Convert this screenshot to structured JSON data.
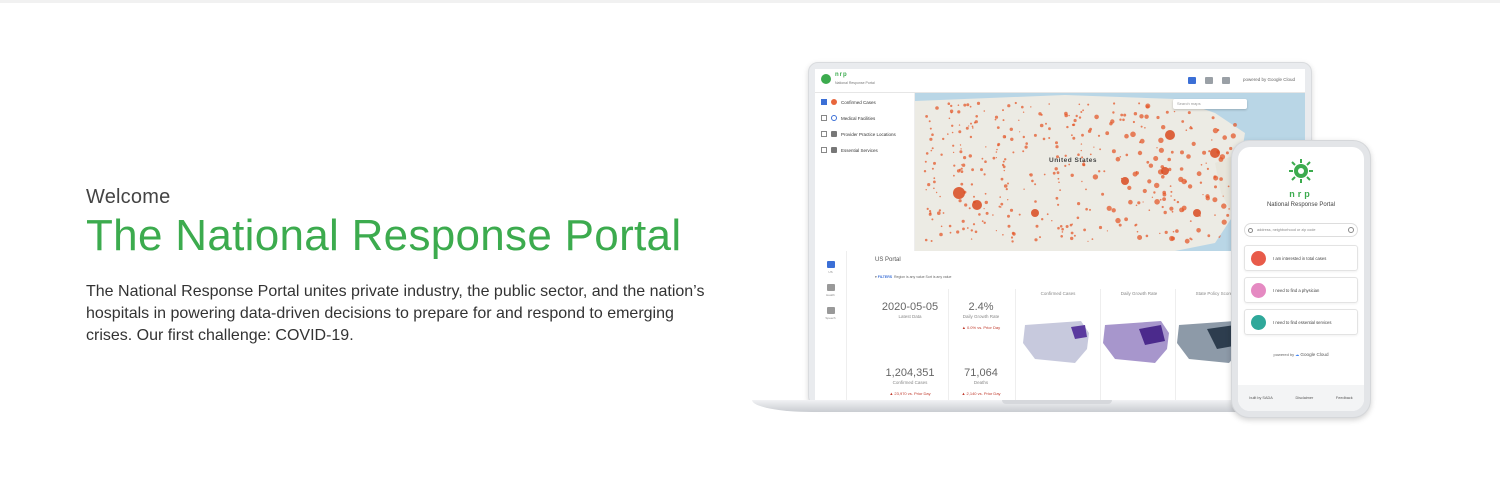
{
  "hero": {
    "welcome": "Welcome",
    "title": "The National Response Portal",
    "description": "The National Response Portal unites private industry, the public sector, and the nation’s hospitals in powering data-driven decisions to prepare for and respond to emerging crises. Our first challenge: COVID-19."
  },
  "laptop": {
    "app": {
      "logo_text": "nrp",
      "logo_sub": "National Response Portal",
      "powered_by": "powered by Google Cloud"
    },
    "layers": [
      {
        "label": "Confirmed Cases",
        "checked": true,
        "color": "#e8663c"
      },
      {
        "label": "Medical Facilities",
        "checked": false,
        "color": "#3b6fd6"
      },
      {
        "label": "Provider Practice Locations",
        "checked": false,
        "color": "#777777"
      },
      {
        "label": "Essential Services",
        "checked": false,
        "color": "#777777"
      }
    ],
    "map": {
      "search_placeholder": "Search maps",
      "country_label": "United States"
    },
    "dashboard": {
      "title": "US Portal",
      "filters_label": "FILTERS",
      "filters_detail": "Region is any value   Sort is any value",
      "nav": [
        "US",
        "Health",
        "Speech"
      ],
      "latest_date": {
        "value": "2020-05-05",
        "label": "Latest Data"
      },
      "growth_rate": {
        "value": "2.4%",
        "label": "Daily Growth Rate",
        "delta": "▲ 0.0% vs. Prior Day"
      },
      "confirmed": {
        "value": "1,204,351",
        "label": "Confirmed Cases",
        "delta": "▲ 23,970 vs. Prior Day"
      },
      "deaths": {
        "value": "71,064",
        "label": "Deaths",
        "delta": "▲ 2,140 vs. Prior Day"
      },
      "map_columns": [
        "Confirmed Cases",
        "Daily Growth Rate",
        "State Policy Score"
      ]
    }
  },
  "phone": {
    "logo_text": "nrp",
    "subtitle": "National Response Portal",
    "search_placeholder": "address, neighborhood or zip code",
    "buttons": [
      {
        "label": "I am interested in total cases",
        "color": "#e85b4a"
      },
      {
        "label": "I need to find a physician",
        "color": "#e58ac2"
      },
      {
        "label": "I need to find essential services",
        "color": "#2fa89a"
      }
    ],
    "powered_prefix": "powered by",
    "powered_brand": "Google Cloud",
    "footer": [
      "built by SADA",
      "Disclaimer",
      "Feedback"
    ]
  },
  "colors": {
    "brand_green": "#3cab4e",
    "accent_blue": "#3b6fd6",
    "case_red": "#e8663c"
  }
}
